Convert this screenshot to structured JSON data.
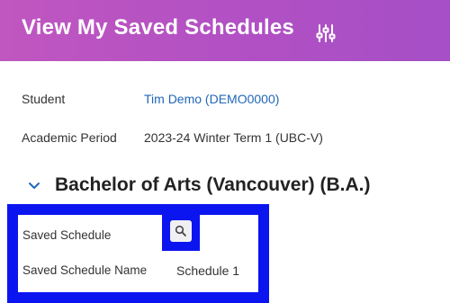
{
  "header": {
    "title": "View My Saved Schedules",
    "icon": "filter-settings-icon"
  },
  "details": {
    "student_label": "Student",
    "student_value": "Tim Demo (DEMO0000)",
    "period_label": "Academic Period",
    "period_value": "2023-24 Winter Term 1 (UBC-V)"
  },
  "section": {
    "chevron_icon": "chevron-down-icon",
    "title": "Bachelor of Arts (Vancouver) (B.A.)"
  },
  "form": {
    "saved_schedule_label": "Saved Schedule",
    "search_icon": "search-icon",
    "saved_schedule_name_label": "Saved Schedule Name",
    "saved_schedule_name_value": "Schedule 1"
  },
  "colors": {
    "header_gradient_start": "#c056c0",
    "header_gradient_end": "#a64fc6",
    "link": "#2167b8",
    "highlight": "#0b15f0"
  }
}
